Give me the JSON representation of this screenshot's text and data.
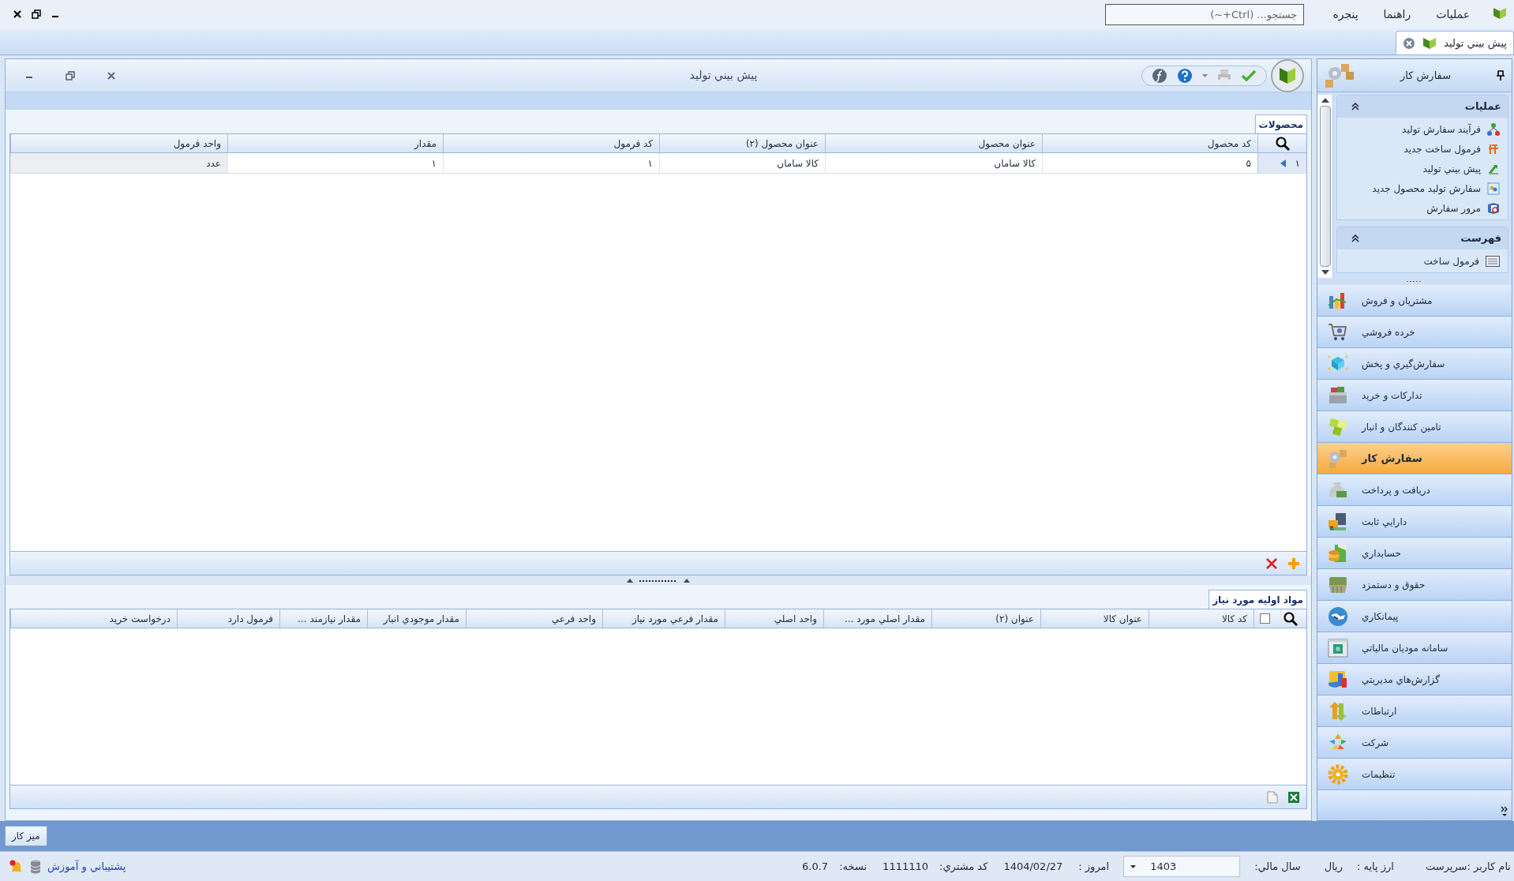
{
  "menu_bar": {
    "items": [
      "عمليات",
      "راهنما",
      "پنجره"
    ],
    "search": {
      "placeholder": "جستجو... (Ctrl+~)"
    }
  },
  "document_tabs": [
    {
      "label": "پيش بيني توليد",
      "selected": true
    }
  ],
  "window": {
    "title": "پيش بيني توليد"
  },
  "products": {
    "tab": "محصولات",
    "columns": [
      "کد محصول",
      "عنوان محصول",
      "عنوان محصول (۲)",
      "کد فرمول",
      "مقدار",
      "واحد فرمول"
    ],
    "rows": [
      {
        "index": "۱",
        "selected": true,
        "cells": [
          "۵",
          "کالا سامان",
          "کالا سامان",
          "۱",
          "۱",
          "عدد"
        ]
      }
    ]
  },
  "materials": {
    "tab": "مواد اوليه مورد نياز",
    "select_all": {
      "checked": false
    },
    "columns": [
      "کد کالا",
      "عنوان کالا",
      "عنوان (۲)",
      "مقدار اصلي مورد ...",
      "واحد اصلي",
      "مقدار فرعي مورد نياز",
      "واحد فرعي",
      "مقدار موجودي انبار",
      "مقدار نيازمند ...",
      "فرمول دارد",
      "درخواست خريد"
    ]
  },
  "sidebar": {
    "title": "سفارش کار",
    "groups": [
      {
        "title": "عمليات",
        "expanded": true,
        "items": [
          "فرآيند سفارش توليد",
          "فرمول ساخت جديد",
          "پيش بيني توليد",
          "سفارش توليد محصول جديد",
          "مرور سفارش"
        ]
      },
      {
        "title": "فهرست",
        "expanded": true,
        "items": [
          "فرمول ساخت"
        ]
      }
    ],
    "modules": [
      {
        "label": "مشتريان و فروش",
        "selected": false
      },
      {
        "label": "خرده فروشي",
        "selected": false
      },
      {
        "label": "سفارش‌گيري و پخش",
        "selected": false
      },
      {
        "label": "تدارکات و خريد",
        "selected": false
      },
      {
        "label": "تامين کنندگان و انبار",
        "selected": false
      },
      {
        "label": "سفارش کار",
        "selected": true
      },
      {
        "label": "دريافت و پرداخت",
        "selected": false
      },
      {
        "label": "دارايي ثابت",
        "selected": false
      },
      {
        "label": "حسابداري",
        "selected": false
      },
      {
        "label": "حقوق و دستمزد",
        "selected": false
      },
      {
        "label": "پيمانکاري",
        "selected": false
      },
      {
        "label": "سامانه موديان مالياتي",
        "selected": false
      },
      {
        "label": "گزارش‌هاي مديريتي",
        "selected": false
      },
      {
        "label": "ارتباطات",
        "selected": false
      },
      {
        "label": "شرکت",
        "selected": false
      },
      {
        "label": "تنظيمات",
        "selected": false
      }
    ]
  },
  "desktop_button": "ميز کار",
  "status_bar": {
    "items": [
      {
        "kind": "text",
        "text": "نام کاربر :سرپرست"
      },
      {
        "kind": "text",
        "text": "ارز پايه :"
      },
      {
        "kind": "text",
        "text": "ريال"
      },
      {
        "kind": "text",
        "text": "سال مالي:"
      },
      {
        "kind": "dropdown",
        "value": "1403"
      },
      {
        "kind": "text",
        "text": "امروز :"
      },
      {
        "kind": "text",
        "text": "1404/02/27"
      },
      {
        "kind": "text",
        "text": "کد مشتري:"
      },
      {
        "kind": "text",
        "text": "1111110"
      },
      {
        "kind": "text",
        "text": "نسخه:"
      },
      {
        "kind": "text",
        "text": "6.0.7"
      }
    ],
    "link": "پشتيباني و آموزش"
  }
}
